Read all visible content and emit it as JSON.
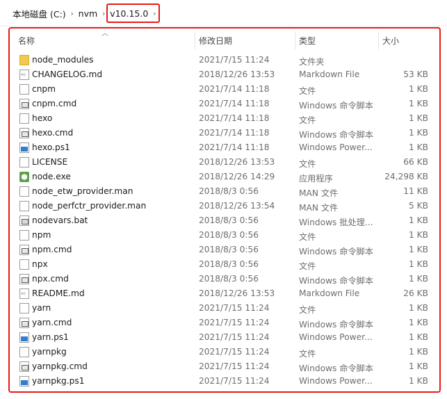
{
  "breadcrumb": {
    "items": [
      "本地磁盘 (C:)",
      "nvm",
      "v10.15.0"
    ]
  },
  "columns": {
    "name": "名称",
    "date": "修改日期",
    "type": "类型",
    "size": "大小"
  },
  "files": [
    {
      "name": "node_modules",
      "date": "2021/7/15 11:24",
      "type": "文件夹",
      "size": "",
      "icon": "folder-icon"
    },
    {
      "name": "CHANGELOG.md",
      "date": "2018/12/26 13:53",
      "type": "Markdown File",
      "size": "53 KB",
      "icon": "markdown-file-icon"
    },
    {
      "name": "cnpm",
      "date": "2021/7/14 11:18",
      "type": "文件",
      "size": "1 KB",
      "icon": "file-icon"
    },
    {
      "name": "cnpm.cmd",
      "date": "2021/7/14 11:18",
      "type": "Windows 命令脚本",
      "size": "1 KB",
      "icon": "cmd-script-icon"
    },
    {
      "name": "hexo",
      "date": "2021/7/14 11:18",
      "type": "文件",
      "size": "1 KB",
      "icon": "file-icon"
    },
    {
      "name": "hexo.cmd",
      "date": "2021/7/14 11:18",
      "type": "Windows 命令脚本",
      "size": "1 KB",
      "icon": "cmd-script-icon"
    },
    {
      "name": "hexo.ps1",
      "date": "2021/7/14 11:18",
      "type": "Windows Power...",
      "size": "1 KB",
      "icon": "powershell-file-icon"
    },
    {
      "name": "LICENSE",
      "date": "2018/12/26 13:53",
      "type": "文件",
      "size": "66 KB",
      "icon": "file-icon"
    },
    {
      "name": "node.exe",
      "date": "2018/12/26 14:29",
      "type": "应用程序",
      "size": "24,298 KB",
      "icon": "nodejs-exe-icon"
    },
    {
      "name": "node_etw_provider.man",
      "date": "2018/8/3 0:56",
      "type": "MAN 文件",
      "size": "11 KB",
      "icon": "file-icon"
    },
    {
      "name": "node_perfctr_provider.man",
      "date": "2018/12/26 13:54",
      "type": "MAN 文件",
      "size": "5 KB",
      "icon": "file-icon"
    },
    {
      "name": "nodevars.bat",
      "date": "2018/8/3 0:56",
      "type": "Windows 批处理...",
      "size": "1 KB",
      "icon": "batch-file-icon"
    },
    {
      "name": "npm",
      "date": "2018/8/3 0:56",
      "type": "文件",
      "size": "1 KB",
      "icon": "file-icon"
    },
    {
      "name": "npm.cmd",
      "date": "2018/8/3 0:56",
      "type": "Windows 命令脚本",
      "size": "1 KB",
      "icon": "cmd-script-icon"
    },
    {
      "name": "npx",
      "date": "2018/8/3 0:56",
      "type": "文件",
      "size": "1 KB",
      "icon": "file-icon"
    },
    {
      "name": "npx.cmd",
      "date": "2018/8/3 0:56",
      "type": "Windows 命令脚本",
      "size": "1 KB",
      "icon": "cmd-script-icon"
    },
    {
      "name": "README.md",
      "date": "2018/12/26 13:53",
      "type": "Markdown File",
      "size": "26 KB",
      "icon": "markdown-file-icon"
    },
    {
      "name": "yarn",
      "date": "2021/7/15 11:24",
      "type": "文件",
      "size": "1 KB",
      "icon": "file-icon"
    },
    {
      "name": "yarn.cmd",
      "date": "2021/7/15 11:24",
      "type": "Windows 命令脚本",
      "size": "1 KB",
      "icon": "cmd-script-icon"
    },
    {
      "name": "yarn.ps1",
      "date": "2021/7/15 11:24",
      "type": "Windows Power...",
      "size": "1 KB",
      "icon": "powershell-file-icon"
    },
    {
      "name": "yarnpkg",
      "date": "2021/7/15 11:24",
      "type": "文件",
      "size": "1 KB",
      "icon": "file-icon"
    },
    {
      "name": "yarnpkg.cmd",
      "date": "2021/7/15 11:24",
      "type": "Windows 命令脚本",
      "size": "1 KB",
      "icon": "cmd-script-icon"
    },
    {
      "name": "yarnpkg.ps1",
      "date": "2021/7/15 11:24",
      "type": "Windows Power...",
      "size": "1 KB",
      "icon": "powershell-file-icon"
    }
  ],
  "colors": {
    "highlight": "#e81818",
    "folder": "#f4c84e",
    "secondary_text": "#6d6d6d"
  }
}
